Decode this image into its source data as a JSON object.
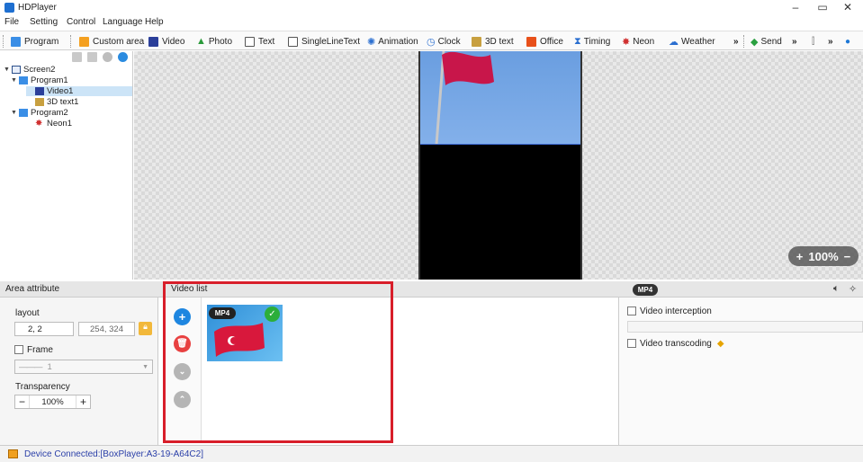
{
  "window": {
    "title": "HDPlayer",
    "minimize": "–",
    "maximize": "▭",
    "close": "✕"
  },
  "menu": [
    "File",
    "Setting",
    "Control",
    "Language",
    "Help"
  ],
  "toolbar": {
    "program": "Program",
    "custom_area": "Custom area",
    "video": "Video",
    "photo": "Photo",
    "text": "Text",
    "single_line_text": "SingleLineText",
    "animation": "Animation",
    "clock": "Clock",
    "text_3d": "3D text",
    "office": "Office",
    "timing": "Timing",
    "neon": "Neon",
    "weather": "Weather",
    "more": "»",
    "send": "Send",
    "more2": "»",
    "more3": "»"
  },
  "tree": {
    "screen": "Screen2",
    "program1": "Program1",
    "video1": "Video1",
    "text3d1": "3D text1",
    "program2": "Program2",
    "neon1": "Neon1"
  },
  "canvas": {
    "zoom": "100%",
    "zoom_plus": "+",
    "zoom_minus": "−"
  },
  "area_attribute": {
    "header": "Area attribute",
    "layout_label": "layout",
    "position": "2, 2",
    "size": "254, 324",
    "frame_label": "Frame",
    "frame_value": "1",
    "transparency_label": "Transparency",
    "transparency_value": "100%",
    "minus": "−",
    "plus": "+"
  },
  "video_list": {
    "header": "Video list",
    "badge": "MP4"
  },
  "video_props": {
    "badge": "MP4",
    "interception": "Video interception",
    "transcoding": "Video transcoding"
  },
  "status": {
    "text": "Device Connected:[BoxPlayer:A3-19-A64C2]"
  }
}
